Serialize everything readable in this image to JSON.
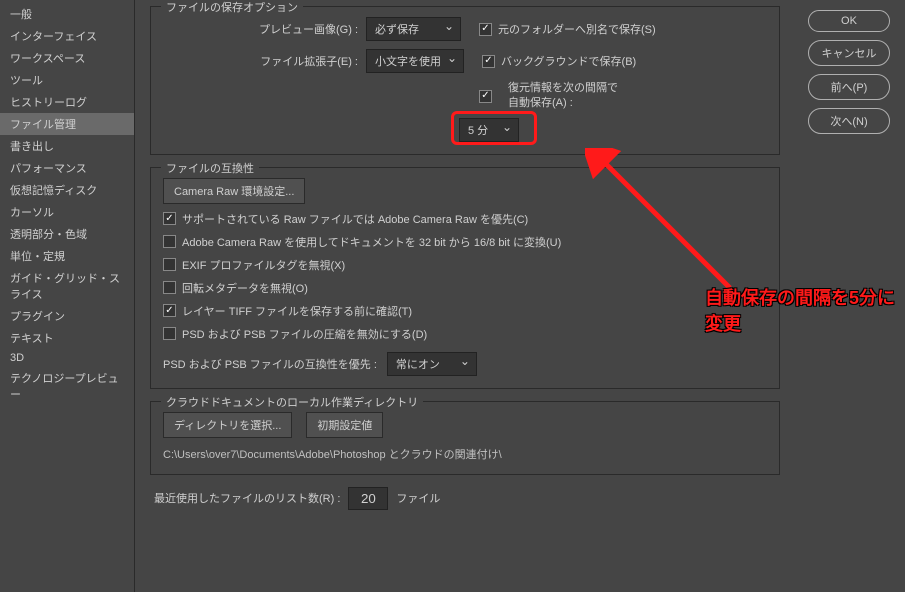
{
  "sidebar": {
    "items": [
      {
        "label": "一般"
      },
      {
        "label": "インターフェイス"
      },
      {
        "label": "ワークスペース"
      },
      {
        "label": "ツール"
      },
      {
        "label": "ヒストリーログ"
      },
      {
        "label": "ファイル管理"
      },
      {
        "label": "書き出し"
      },
      {
        "label": "パフォーマンス"
      },
      {
        "label": "仮想記憶ディスク"
      },
      {
        "label": "カーソル"
      },
      {
        "label": "透明部分・色域"
      },
      {
        "label": "単位・定規"
      },
      {
        "label": "ガイド・グリッド・スライス"
      },
      {
        "label": "プラグイン"
      },
      {
        "label": "テキスト"
      },
      {
        "label": "3D"
      },
      {
        "label": "テクノロジープレビュー"
      }
    ]
  },
  "buttons": {
    "ok": "OK",
    "cancel": "キャンセル",
    "prev": "前へ(P)",
    "next": "次へ(N)"
  },
  "saveOptions": {
    "legend": "ファイルの保存オプション",
    "previewLabel": "プレビュー画像(G) :",
    "previewValue": "必ず保存",
    "extLabel": "ファイル拡張子(E) :",
    "extValue": "小文字を使用",
    "saveAsOriginal": "元のフォルダーへ別名で保存(S)",
    "saveBackground": "バックグラウンドで保存(B)",
    "autoSaveLine1": "復元情報を次の間隔で",
    "autoSaveLine2": "自動保存(A) :",
    "intervalValue": "5 分"
  },
  "compat": {
    "legend": "ファイルの互換性",
    "cameraRawBtn": "Camera Raw 環境設定...",
    "preferCameraRaw": "サポートされている Raw ファイルでは Adobe Camera Raw を優先(C)",
    "convert32": "Adobe Camera Raw を使用してドキュメントを 32 bit から 16/8 bit に変換(U)",
    "ignoreExif": "EXIF プロファイルタグを無視(X)",
    "ignoreRotation": "回転メタデータを無視(O)",
    "confirmTiff": "レイヤー TIFF ファイルを保存する前に確認(T)",
    "disablePsdCompress": "PSD および PSB ファイルの圧縮を無効にする(D)",
    "psdCompatLabel": "PSD および PSB ファイルの互換性を優先 :",
    "psdCompatValue": "常にオン"
  },
  "cloud": {
    "legend": "クラウドドキュメントのローカル作業ディレクトリ",
    "chooseBtn": "ディレクトリを選択...",
    "defaultBtn": "初期設定値",
    "path": "C:\\Users\\over7\\Documents\\Adobe\\Photoshop とクラウドの関連付け\\"
  },
  "recent": {
    "label": "最近使用したファイルのリスト数(R) :",
    "value": "20",
    "unit": "ファイル"
  },
  "annotation": "自動保存の間隔を5分に変更"
}
